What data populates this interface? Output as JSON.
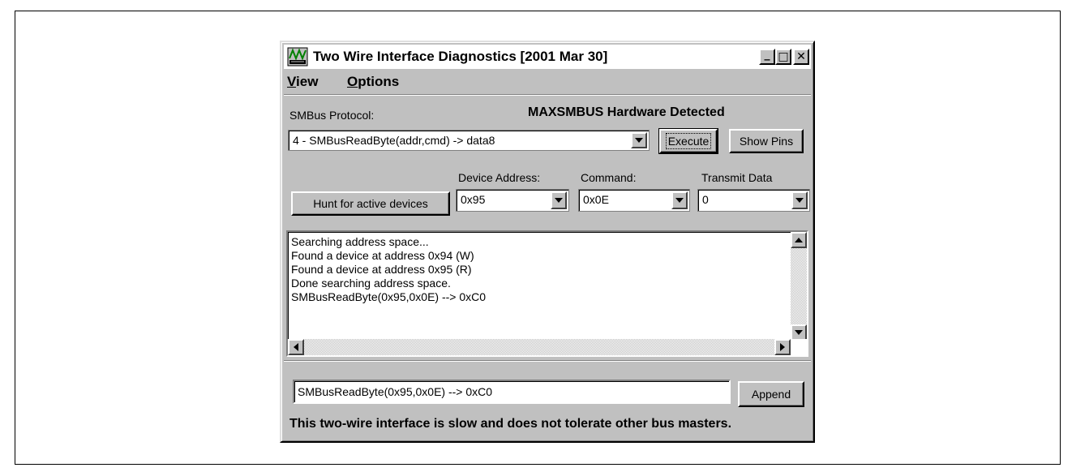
{
  "window": {
    "title": "Two Wire Interface Diagnostics [2001 Mar 30]",
    "controls": {
      "minimize": "_",
      "maximize": "□",
      "close": "✕"
    }
  },
  "menu": {
    "view": {
      "accel": "V",
      "rest": "iew"
    },
    "options": {
      "accel": "O",
      "rest": "ptions"
    }
  },
  "protocol": {
    "label": "SMBus Protocol:",
    "selected": "4 - SMBusReadByte(addr,cmd) -> data8",
    "hardware_status": "MAXSMBUS Hardware Detected"
  },
  "buttons": {
    "execute": "Execute",
    "show_pins": "Show Pins",
    "hunt": "Hunt for active devices",
    "append": "Append"
  },
  "device_address": {
    "label": "Device Address:",
    "value": "0x95"
  },
  "command": {
    "label": "Command:",
    "value": "0x0E"
  },
  "transmit": {
    "label": "Transmit Data",
    "value": "0"
  },
  "log": {
    "lines": [
      "Searching address space...",
      "Found a device at address 0x94 (W)",
      "Found a device at address 0x95 (R)",
      "Done searching address space.",
      "SMBusReadByte(0x95,0x0E) --> 0xC0"
    ]
  },
  "append_input": {
    "value": "SMBusReadByte(0x95,0x0E) --> 0xC0"
  },
  "footer": {
    "note": "This two-wire interface is slow and does not tolerate other bus masters."
  }
}
